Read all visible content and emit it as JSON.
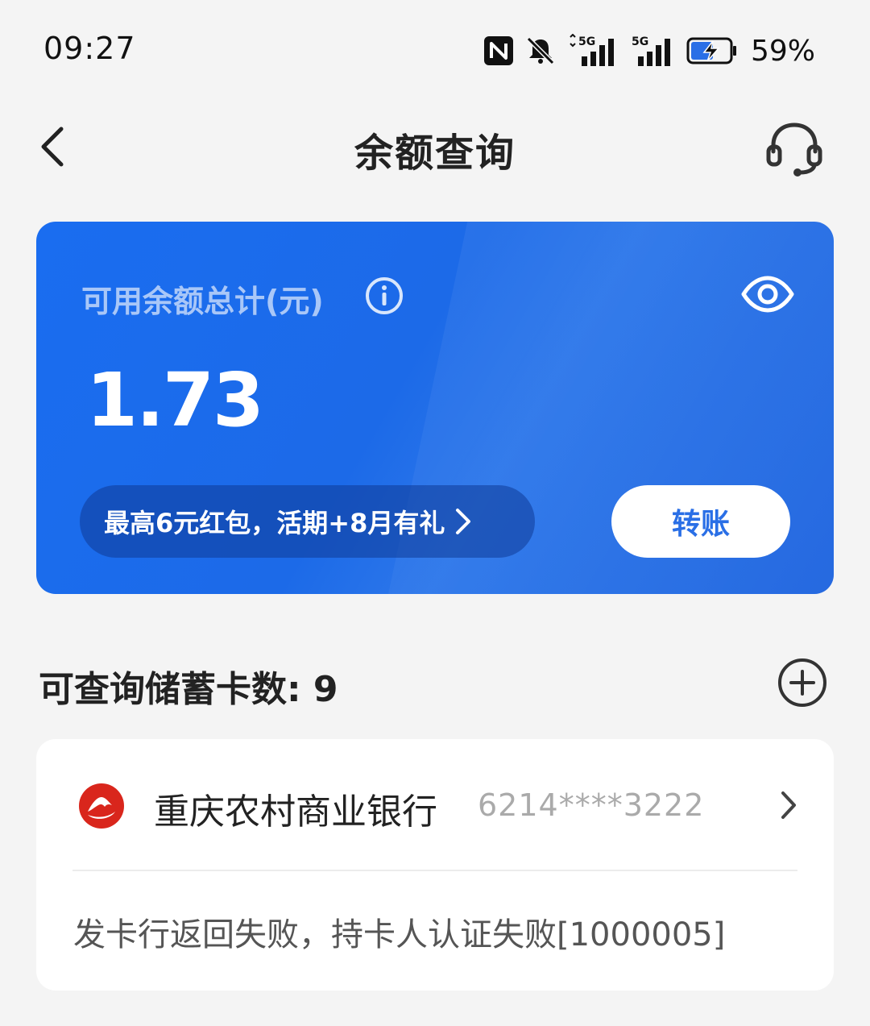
{
  "status_bar": {
    "time": "09:27",
    "battery_percent": "59%",
    "icons": [
      "nfc-icon",
      "bell-off-icon",
      "signal-5g-icon",
      "signal-5g-icon",
      "battery-charging-icon"
    ]
  },
  "header": {
    "title": "余额查询",
    "back_icon": "chevron-left-icon",
    "service_icon": "headset-icon"
  },
  "balance_card": {
    "label": "可用余额总计(元)",
    "amount": "1.73",
    "promo_text": "最高6元红包，活期+8月有礼",
    "transfer_label": "转账",
    "gradient_color": "#1a6df0"
  },
  "section": {
    "title": "可查询储蓄卡数: 9"
  },
  "cards": [
    {
      "bank_name": "重庆农村商业银行",
      "card_number": "6214****3222",
      "status_message": "发卡行返回失败，持卡人认证失败[1000005]",
      "logo_color": "#d9261c"
    }
  ]
}
